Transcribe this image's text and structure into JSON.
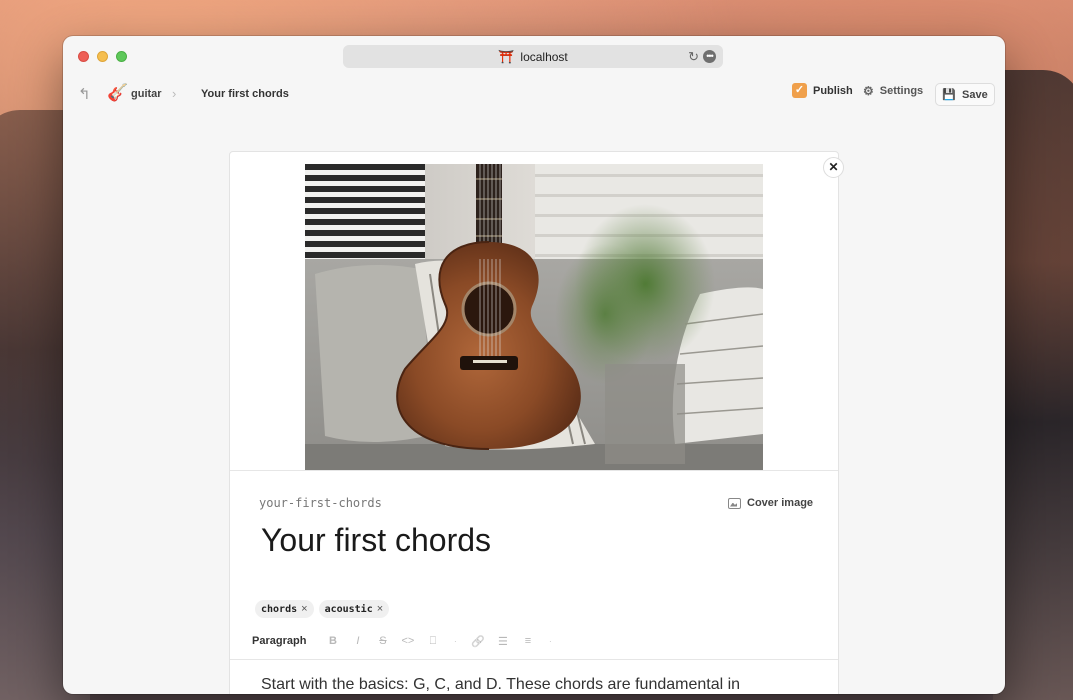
{
  "browser": {
    "url": "localhost",
    "favicon": "⛩️"
  },
  "toolbar": {
    "back_icon": "↰",
    "site_icon": "🎸",
    "site_label": "guitar",
    "chevron": "›",
    "page_label": "Your first chords",
    "publish_label": "Publish",
    "publish_checked": true,
    "settings_label": "Settings",
    "save_label": "Save"
  },
  "editor": {
    "close_glyph": "✕",
    "slug": "your-first-chords",
    "cover_image_label": "Cover image",
    "title": "Your first chords",
    "tags": [
      {
        "label": "chords"
      },
      {
        "label": "acoustic"
      }
    ],
    "tag_remove_glyph": "×",
    "format": {
      "paragraph_label": "Paragraph",
      "buttons": [
        "B",
        "I",
        "S",
        "<>",
        "⎕",
        "·",
        "🔗",
        "☰",
        "≡",
        "·"
      ]
    },
    "body_text": "Start with the basics: G, C, and D. These chords are fundamental in"
  },
  "colors": {
    "publish_check": "#f0a04b",
    "window_bg": "#f6f6f6"
  }
}
